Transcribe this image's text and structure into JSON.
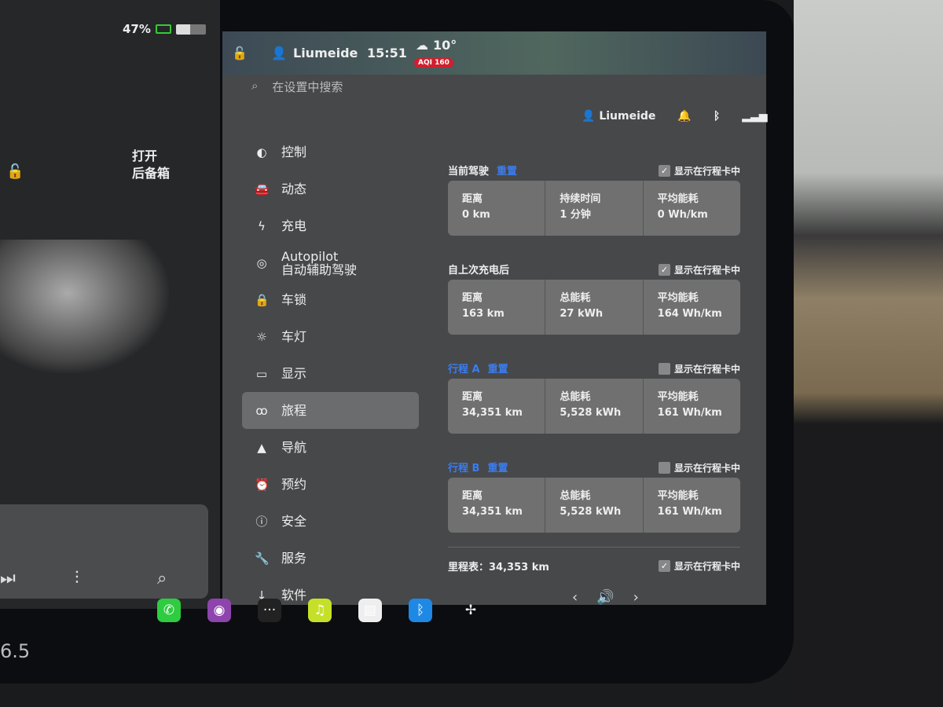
{
  "status": {
    "battery_percent": "47%",
    "battery_level": 0.47
  },
  "car_panel": {
    "trunk_label": "打开\n后备箱",
    "lock_icon": "unlock-icon",
    "speed_partial": "6.5",
    "media_controls": [
      "next-track-icon",
      "equalizer-icon",
      "search-icon"
    ]
  },
  "topbar": {
    "user": "Liumeide",
    "time": "15:51",
    "temperature": "10°",
    "aqi": "AQI 160",
    "weather_icon": "rain-cloud-icon"
  },
  "search": {
    "placeholder": "在设置中搜索"
  },
  "profile": {
    "user": "Liumeide",
    "icons": [
      "bell-icon",
      "bluetooth-icon",
      "signal-icon"
    ]
  },
  "nav": [
    {
      "label": "控制",
      "icon": "toggle-icon"
    },
    {
      "label": "动态",
      "icon": "car-icon"
    },
    {
      "label": "充电",
      "icon": "bolt-icon"
    },
    {
      "label": "Autopilot\n自动辅助驾驶",
      "icon": "steering-wheel-icon"
    },
    {
      "label": "车锁",
      "icon": "lock-icon"
    },
    {
      "label": "车灯",
      "icon": "sun-icon"
    },
    {
      "label": "显示",
      "icon": "display-icon"
    },
    {
      "label": "旅程",
      "icon": "trip-icon",
      "active": true
    },
    {
      "label": "导航",
      "icon": "navigation-icon"
    },
    {
      "label": "预约",
      "icon": "alarm-icon"
    },
    {
      "label": "安全",
      "icon": "alert-icon"
    },
    {
      "label": "服务",
      "icon": "wrench-icon"
    },
    {
      "label": "软件",
      "icon": "download-icon"
    }
  ],
  "trips": [
    {
      "title": "当前驾驶",
      "reset": "重置",
      "title_blue": false,
      "show_label": "显示在行程卡中",
      "checked": true,
      "stats": [
        {
          "label": "距离",
          "value": "0 km"
        },
        {
          "label": "持续时间",
          "value": "1 分钟"
        },
        {
          "label": "平均能耗",
          "value": "0 Wh/km"
        }
      ]
    },
    {
      "title": "自上次充电后",
      "reset": "",
      "title_blue": false,
      "show_label": "显示在行程卡中",
      "checked": true,
      "stats": [
        {
          "label": "距离",
          "value": "163 km"
        },
        {
          "label": "总能耗",
          "value": "27 kWh"
        },
        {
          "label": "平均能耗",
          "value": "164 Wh/km"
        }
      ]
    },
    {
      "title": "行程 A",
      "reset": "重置",
      "title_blue": true,
      "show_label": "显示在行程卡中",
      "checked": false,
      "stats": [
        {
          "label": "距离",
          "value": "34,351 km"
        },
        {
          "label": "总能耗",
          "value": "5,528 kWh"
        },
        {
          "label": "平均能耗",
          "value": "161 Wh/km"
        }
      ]
    },
    {
      "title": "行程 B",
      "reset": "重置",
      "title_blue": true,
      "show_label": "显示在行程卡中",
      "checked": false,
      "stats": [
        {
          "label": "距离",
          "value": "34,351 km"
        },
        {
          "label": "总能耗",
          "value": "5,528 kWh"
        },
        {
          "label": "平均能耗",
          "value": "161 Wh/km"
        }
      ]
    }
  ],
  "odometer": {
    "label": "里程表：34,353 km",
    "show_label": "显示在行程卡中",
    "checked": true
  },
  "dock": [
    {
      "icon": "phone-icon",
      "color": "#2ecc40"
    },
    {
      "icon": "camera-icon",
      "color": "#8e44ad"
    },
    {
      "icon": "more-icon",
      "color": "#222"
    },
    {
      "icon": "music-icon",
      "color": "#c6e02a"
    },
    {
      "icon": "notes-icon",
      "color": "#eee"
    },
    {
      "icon": "bluetooth-icon",
      "color": "#1e88e5"
    },
    {
      "icon": "fan-icon",
      "color": "transparent"
    }
  ],
  "volume": {
    "icon": "volume-icon"
  }
}
